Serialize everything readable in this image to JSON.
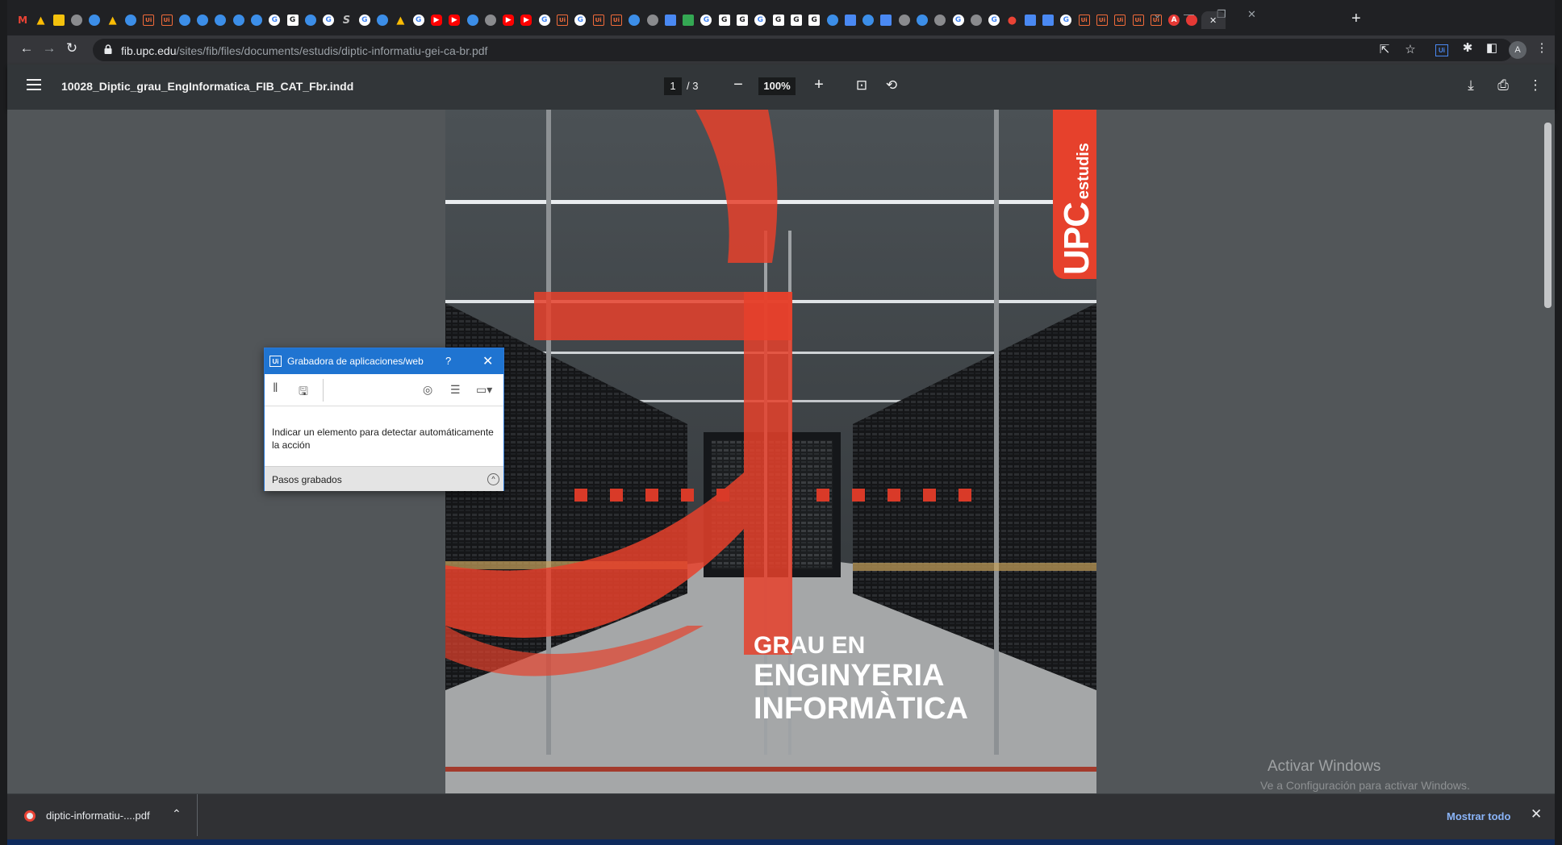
{
  "browser": {
    "tabs": [
      {
        "icon": "gmail-icon",
        "glyph": "M",
        "cls": "gmail"
      },
      {
        "icon": "drive-icon",
        "glyph": "▲",
        "cls": "drive"
      },
      {
        "icon": "note-icon",
        "glyph": "",
        "cls": "note"
      },
      {
        "icon": "chrome-icon",
        "glyph": "",
        "cls": "chrome"
      },
      {
        "icon": "globe-icon",
        "glyph": "",
        "cls": "globe"
      },
      {
        "icon": "drive-icon",
        "glyph": "▲",
        "cls": "drive"
      },
      {
        "icon": "globe-icon",
        "glyph": "",
        "cls": "globe"
      },
      {
        "icon": "uipath-icon",
        "glyph": "Ui",
        "cls": "ui"
      },
      {
        "icon": "uipath-icon",
        "glyph": "Ui",
        "cls": "ui"
      },
      {
        "icon": "globe-icon",
        "glyph": "",
        "cls": "globe"
      },
      {
        "icon": "globe-icon",
        "glyph": "",
        "cls": "globe"
      },
      {
        "icon": "globe-icon",
        "glyph": "",
        "cls": "globe"
      },
      {
        "icon": "globe-icon",
        "glyph": "",
        "cls": "globe"
      },
      {
        "icon": "globe-icon",
        "glyph": "",
        "cls": "globe"
      },
      {
        "icon": "google-icon",
        "glyph": "G",
        "cls": "google"
      },
      {
        "icon": "google-g-box-icon",
        "glyph": "G",
        "cls": "gbox"
      },
      {
        "icon": "globe-icon",
        "glyph": "",
        "cls": "globe"
      },
      {
        "icon": "google-icon",
        "glyph": "G",
        "cls": "google"
      },
      {
        "icon": "script-icon",
        "glyph": "S",
        "cls": "s"
      },
      {
        "icon": "google-icon",
        "glyph": "G",
        "cls": "google"
      },
      {
        "icon": "globe-icon",
        "glyph": "",
        "cls": "globe"
      },
      {
        "icon": "drive-icon",
        "glyph": "▲",
        "cls": "drive"
      },
      {
        "icon": "google-icon",
        "glyph": "G",
        "cls": "google"
      },
      {
        "icon": "youtube-icon",
        "glyph": "▶",
        "cls": "yt"
      },
      {
        "icon": "youtube-icon",
        "glyph": "▶",
        "cls": "yt"
      },
      {
        "icon": "globe-icon",
        "glyph": "",
        "cls": "globe"
      },
      {
        "icon": "chrome-icon",
        "glyph": "",
        "cls": "chrome"
      },
      {
        "icon": "youtube-icon",
        "glyph": "▶",
        "cls": "yt"
      },
      {
        "icon": "youtube-icon",
        "glyph": "▶",
        "cls": "yt"
      },
      {
        "icon": "google-icon",
        "glyph": "G",
        "cls": "google"
      },
      {
        "icon": "uipath-icon",
        "glyph": "Ui",
        "cls": "ui"
      },
      {
        "icon": "google-icon",
        "glyph": "G",
        "cls": "google"
      },
      {
        "icon": "uipath-icon",
        "glyph": "Ui",
        "cls": "ui"
      },
      {
        "icon": "uipath-icon",
        "glyph": "Ui",
        "cls": "ui"
      },
      {
        "icon": "globe-icon",
        "glyph": "",
        "cls": "globe"
      },
      {
        "icon": "chrome-icon",
        "glyph": "",
        "cls": "chrome"
      },
      {
        "icon": "doc-icon",
        "glyph": "",
        "cls": "doc"
      },
      {
        "icon": "sheet-icon",
        "glyph": "",
        "cls": "grn"
      },
      {
        "icon": "google-icon",
        "glyph": "G",
        "cls": "google"
      },
      {
        "icon": "google-g-box-icon",
        "glyph": "G",
        "cls": "gbox"
      },
      {
        "icon": "google-g-box-icon",
        "glyph": "G",
        "cls": "gbox"
      },
      {
        "icon": "google-icon",
        "glyph": "G",
        "cls": "google"
      },
      {
        "icon": "google-g-box-icon",
        "glyph": "G",
        "cls": "gbox"
      },
      {
        "icon": "google-g-box-icon",
        "glyph": "G",
        "cls": "gbox"
      },
      {
        "icon": "google-g-box-icon",
        "glyph": "G",
        "cls": "gbox"
      },
      {
        "icon": "globe-icon",
        "glyph": "",
        "cls": "globe"
      },
      {
        "icon": "doc-icon",
        "glyph": "",
        "cls": "doc"
      },
      {
        "icon": "globe-icon",
        "glyph": "",
        "cls": "globe"
      },
      {
        "icon": "doc-icon",
        "glyph": "",
        "cls": "doc"
      },
      {
        "icon": "chrome-icon",
        "glyph": "",
        "cls": "chrome"
      },
      {
        "icon": "globe-icon",
        "glyph": "",
        "cls": "globe"
      },
      {
        "icon": "chrome-icon",
        "glyph": "",
        "cls": "chrome"
      },
      {
        "icon": "google-icon",
        "glyph": "G",
        "cls": "google"
      },
      {
        "icon": "chrome-icon",
        "glyph": "",
        "cls": "chrome"
      },
      {
        "icon": "google-icon",
        "glyph": "G",
        "cls": "google"
      },
      {
        "icon": "maps-pin-icon",
        "glyph": "●",
        "cls": "map"
      },
      {
        "icon": "extension-icon",
        "glyph": "",
        "cls": "doc"
      },
      {
        "icon": "news-icon",
        "glyph": "",
        "cls": "doc"
      },
      {
        "icon": "google-icon",
        "glyph": "G",
        "cls": "google"
      },
      {
        "icon": "uipath-icon",
        "glyph": "Ui",
        "cls": "ui"
      },
      {
        "icon": "uipath-icon",
        "glyph": "Ui",
        "cls": "ui"
      },
      {
        "icon": "uipath-icon",
        "glyph": "Ui",
        "cls": "ui"
      },
      {
        "icon": "uipath-icon",
        "glyph": "Ui",
        "cls": "ui"
      },
      {
        "icon": "uipath-icon",
        "glyph": "Ui",
        "cls": "ui"
      },
      {
        "icon": "acrobat-icon",
        "glyph": "A",
        "cls": "red"
      },
      {
        "icon": "record-icon",
        "glyph": "",
        "cls": "red"
      },
      {
        "icon": "pdf-tab-close-icon",
        "glyph": "✕",
        "cls": "active"
      }
    ],
    "new_tab": "+",
    "address": {
      "host": "fib.upc.edu",
      "path": "/sites/fib/files/documents/estudis/diptic-informatiu-gei-ca-br.pdf"
    },
    "profile_initial": "A",
    "extension_label": "Ui"
  },
  "pdf": {
    "filename": "10028_Diptic_grau_EngInformatica_FIB_CAT_Fbr.indd",
    "current_page": "1",
    "total_pages": "/ 3",
    "zoom": "100%",
    "cover": {
      "brand": "UPC",
      "brand_sub": "estudis",
      "title_line1": "GRAU EN",
      "title_line2": "ENGINYERIA",
      "title_line3": "INFORMÀTICA"
    }
  },
  "recorder": {
    "app_icon_label": "Ui",
    "title": "Grabadora de aplicaciones/web",
    "help": "?",
    "message": "Indicar un elemento para detectar automáticamente la acción",
    "steps_label": "Pasos grabados"
  },
  "watermark": {
    "line1": "Activar Windows",
    "line2": "Ve a Configuración para activar Windows."
  },
  "downloads": {
    "file": "diptic-informatiu-....pdf",
    "show_all": "Mostrar todo"
  }
}
